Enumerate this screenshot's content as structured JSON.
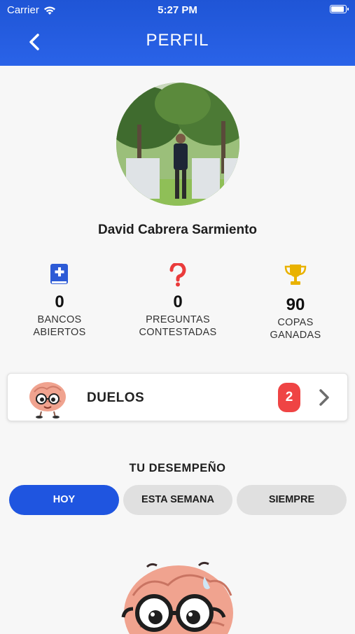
{
  "status_bar": {
    "carrier": "Carrier",
    "time": "5:27 PM"
  },
  "header": {
    "title": "PERFIL"
  },
  "profile": {
    "name": "David Cabrera Sarmiento"
  },
  "stats": [
    {
      "value": "0",
      "label_line1": "BANCOS",
      "label_line2": "ABIERTOS",
      "icon": "book-plus-icon",
      "color": "#2d5bd6"
    },
    {
      "value": "0",
      "label_line1": "PREGUNTAS",
      "label_line2": "CONTESTADAS",
      "icon": "question-mark-icon",
      "color": "#ea3b3b"
    },
    {
      "value": "90",
      "label_line1": "COPAS",
      "label_line2": "GANADAS",
      "icon": "trophy-icon",
      "color": "#e9b200"
    }
  ],
  "duelos": {
    "title": "DUELOS",
    "badge": "2"
  },
  "performance": {
    "title": "TU DESEMPEÑO",
    "tabs": [
      {
        "label": "HOY",
        "active": true
      },
      {
        "label": "ESTA SEMANA",
        "active": false
      },
      {
        "label": "SIEMPRE",
        "active": false
      }
    ]
  },
  "colors": {
    "header": "#2a63e8",
    "accent": "#1f55e0",
    "badge": "#ef4444"
  }
}
